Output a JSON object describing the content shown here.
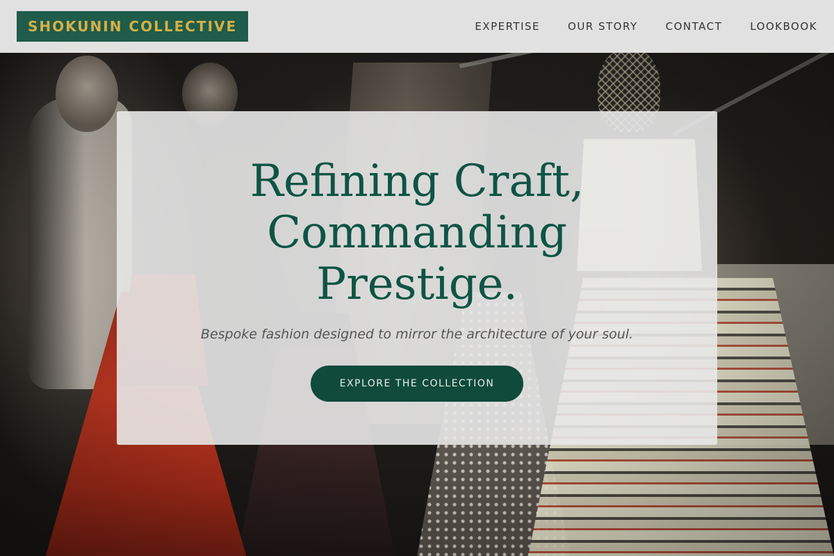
{
  "header": {
    "logo_text": "SHOKUNIN COLLECTIVE",
    "nav": [
      {
        "label": "EXPERTISE"
      },
      {
        "label": "OUR STORY"
      },
      {
        "label": "CONTACT"
      },
      {
        "label": "LOOKBOOK"
      }
    ]
  },
  "hero": {
    "title_lines": [
      "Refining Craft,",
      "Commanding",
      "Prestige."
    ],
    "subtitle": "Bespoke fashion designed to mirror the architecture of your soul.",
    "cta_label": "EXPLORE THE COLLECTION"
  },
  "colors": {
    "brand_green": "#1f5c4a",
    "brand_gold": "#d6b046",
    "title_green": "#0f5443",
    "button_green": "#0f4a3a"
  }
}
